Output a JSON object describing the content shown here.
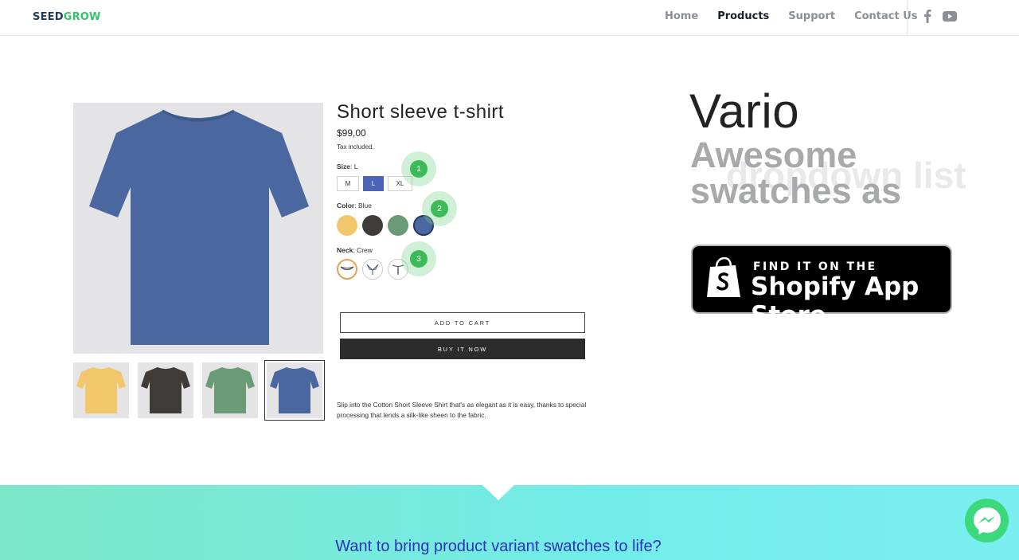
{
  "nav": {
    "logo_part1": "SEED",
    "logo_part2": "GROW",
    "items": [
      {
        "label": "Home",
        "active": false
      },
      {
        "label": "Products",
        "active": true
      },
      {
        "label": "Support",
        "active": false
      },
      {
        "label": "Contact Us",
        "active": false
      }
    ],
    "social_icons": [
      "facebook-icon",
      "youtube-icon"
    ]
  },
  "product": {
    "title": "Short sleeve t-shirt",
    "price": "$99,00",
    "tax_note": "Tax included.",
    "size": {
      "label": "Size",
      "value": "L",
      "options": [
        "M",
        "L",
        "XL"
      ],
      "selected": "L"
    },
    "color": {
      "label": "Color",
      "value": "Blue",
      "options": [
        {
          "name": "Yellow",
          "hex": "#f2c76b"
        },
        {
          "name": "Dark",
          "hex": "#3e3b38"
        },
        {
          "name": "Green",
          "hex": "#6a9a76"
        },
        {
          "name": "Blue",
          "hex": "#4b67a0"
        }
      ],
      "selected": "Blue"
    },
    "neck": {
      "label": "Neck",
      "value": "Crew",
      "options": [
        "Crew",
        "Polo",
        "Henley"
      ],
      "selected": "Crew"
    },
    "steps": [
      "1",
      "2",
      "3"
    ],
    "add_to_cart": "ADD TO CART",
    "buy_now": "BUY IT NOW",
    "description": "Slip into the Cotton Short Sleeve Shirt that's as elegant as it is easy, thanks to special processing that lends a silk-like sheen to the fabric.",
    "thumbnail_colors": [
      "#f2c76b",
      "#3e3b38",
      "#6a9a76",
      "#4b67a0"
    ],
    "main_image_color": "#4b67a0"
  },
  "hero": {
    "title": "Vario",
    "subtitle": "Awesome swatches as",
    "ghost_text": "dropdown list",
    "badge_line1": "FIND IT ON THE",
    "badge_line2": "Shopify App Store"
  },
  "band": {
    "text": "Want to bring product variant swatches to life?"
  },
  "colors": {
    "accent_green": "#3dbb59",
    "accent_blue": "#4c64b8",
    "band_text": "#2b34b8"
  }
}
